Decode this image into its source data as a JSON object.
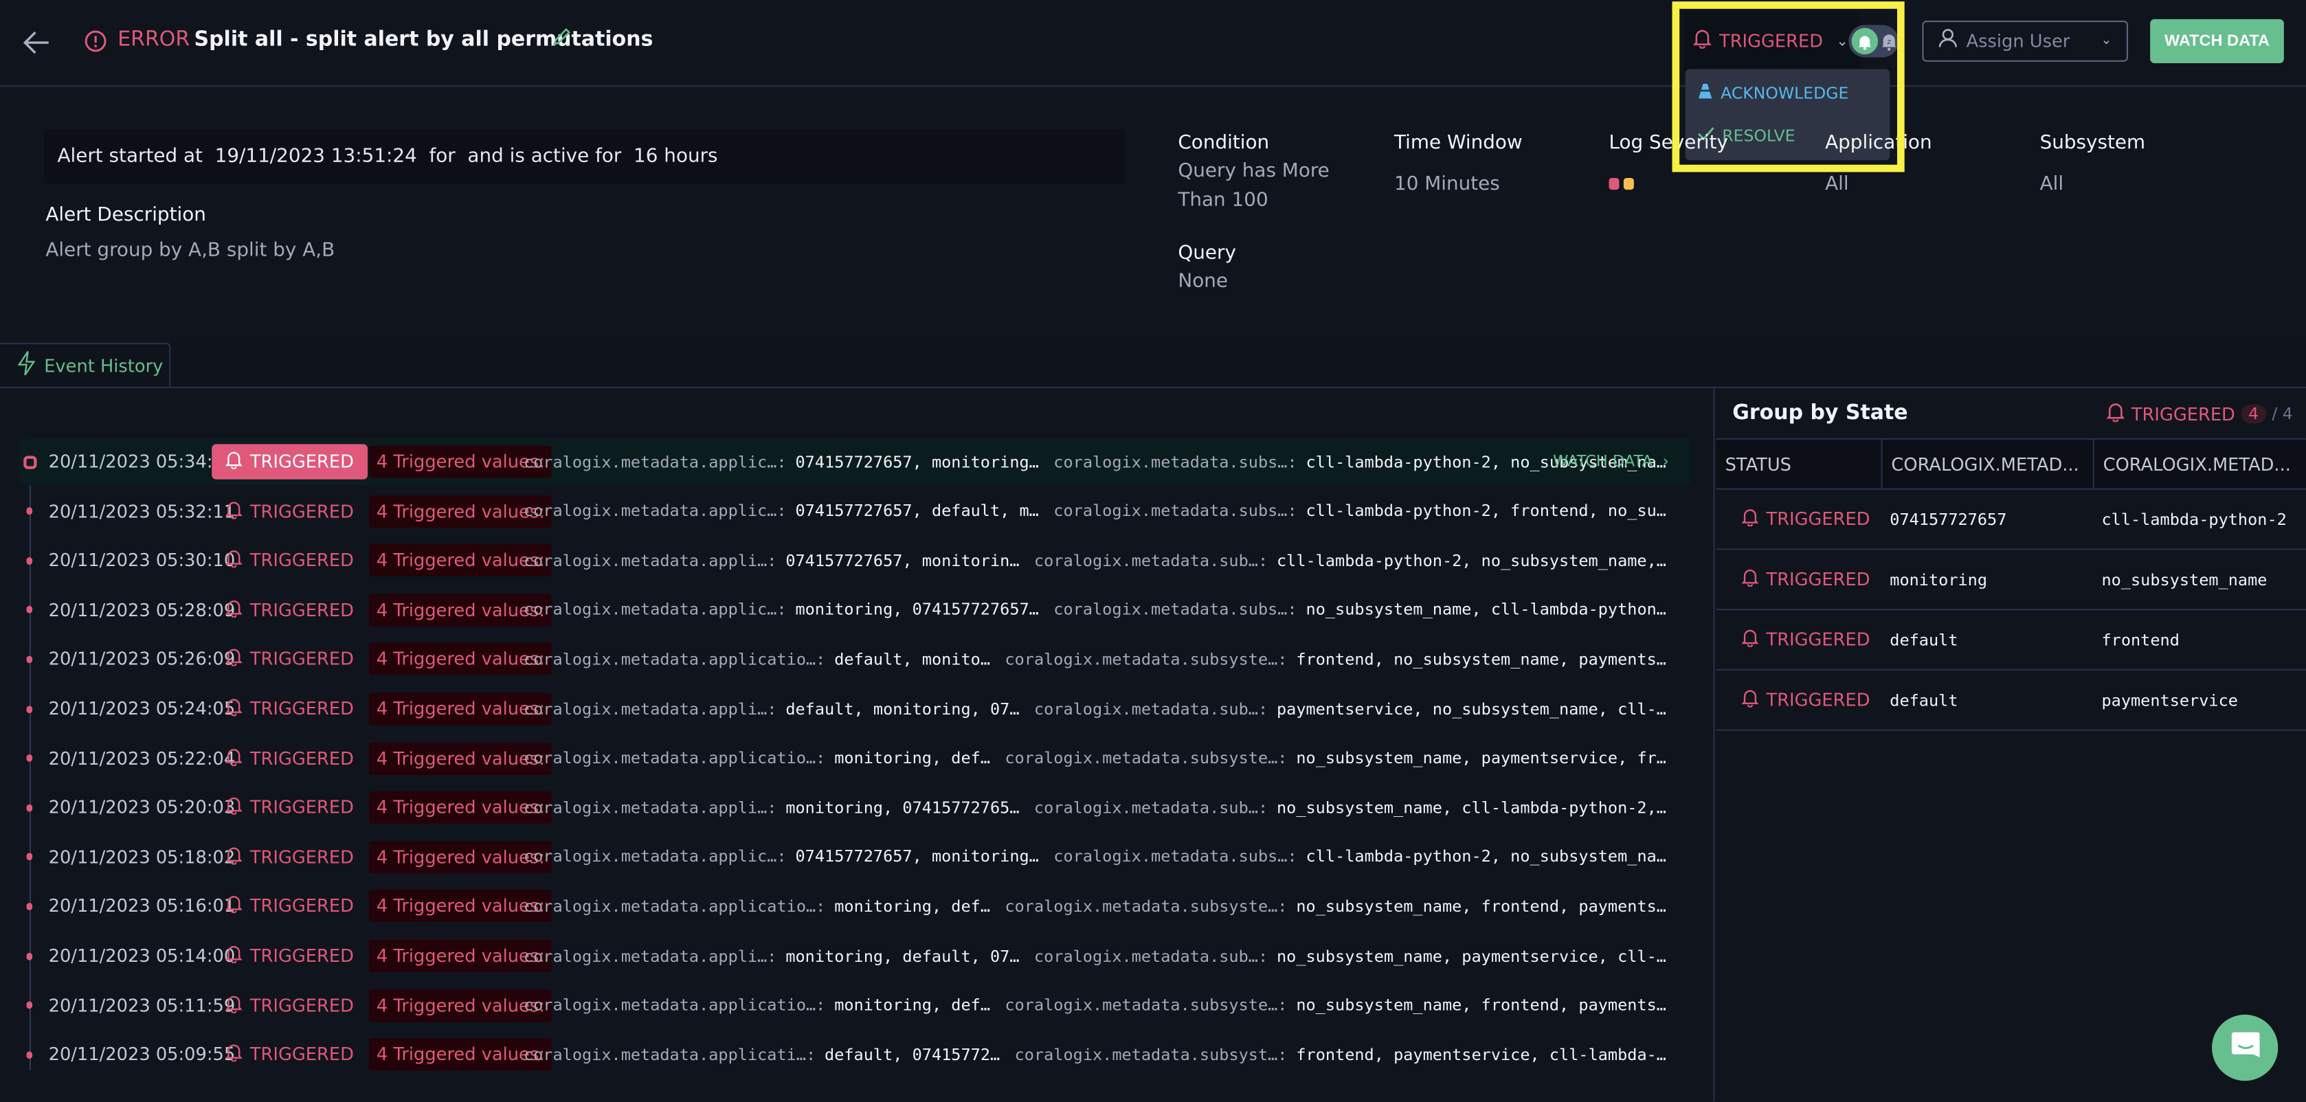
{
  "header": {
    "back_label": "Back",
    "severity": "ERROR",
    "title": "Split all - split alert by all permutations",
    "status_dropdown": {
      "label": "TRIGGERED"
    },
    "status_menu": [
      {
        "label": "ACKNOWLEDGE",
        "icon": "cone-icon",
        "color": "#58b8eb"
      },
      {
        "label": "RESOLVE",
        "icon": "check-icon",
        "color": "#67be8e"
      }
    ],
    "assign_user": {
      "placeholder": "Assign User"
    },
    "watch_data_label": "WATCH DATA"
  },
  "info": {
    "started_text": "Alert started at  19/11/2023 13:51:24  for  and is active for  16 hours",
    "description_heading": "Alert Description",
    "description": "Alert group by A,B split by A,B",
    "condition": {
      "heading": "Condition",
      "value": "Query has More Than 100"
    },
    "time_window": {
      "heading": "Time Window",
      "value": "10 Minutes"
    },
    "log_severity": {
      "heading": "Log Severity",
      "colors": [
        "#e0587a",
        "#f5c14c"
      ]
    },
    "application": {
      "heading": "Application",
      "value": "All"
    },
    "subsystem": {
      "heading": "Subsystem",
      "value": "All"
    },
    "query": {
      "heading": "Query",
      "value": "None"
    }
  },
  "tabs": [
    {
      "label": "Event History"
    }
  ],
  "events": {
    "status_label": "TRIGGERED",
    "values_label": "4 Triggered values:",
    "watch_data_label": "WATCH DATA",
    "rows": [
      {
        "time": "20/11/2023 05:34:12",
        "k1": "coralogix.metadata.applic…:",
        "v1": "074157727657, monitoring…",
        "k2": "coralogix.metadata.subs…:",
        "v2": "cll-lambda-python-2, no_subsystem_na…",
        "active": true
      },
      {
        "time": "20/11/2023 05:32:11",
        "k1": "coralogix.metadata.applic…:",
        "v1": "074157727657, default, m…",
        "k2": "coralogix.metadata.subs…:",
        "v2": "cll-lambda-python-2, frontend, no_su…"
      },
      {
        "time": "20/11/2023 05:30:10",
        "k1": "coralogix.metadata.appli…:",
        "v1": "074157727657, monitorin…",
        "k2": "coralogix.metadata.sub…:",
        "v2": "cll-lambda-python-2, no_subsystem_name,…"
      },
      {
        "time": "20/11/2023 05:28:09",
        "k1": "coralogix.metadata.applic…:",
        "v1": "monitoring, 074157727657…",
        "k2": "coralogix.metadata.subs…:",
        "v2": "no_subsystem_name, cll-lambda-python…"
      },
      {
        "time": "20/11/2023 05:26:09",
        "k1": "coralogix.metadata.applicatio…:",
        "v1": "default, monito…",
        "k2": "coralogix.metadata.subsyste…:",
        "v2": "frontend, no_subsystem_name, payments…"
      },
      {
        "time": "20/11/2023 05:24:05",
        "k1": "coralogix.metadata.appli…:",
        "v1": "default, monitoring, 07…",
        "k2": "coralogix.metadata.sub…:",
        "v2": "paymentservice, no_subsystem_name, cll-…"
      },
      {
        "time": "20/11/2023 05:22:04",
        "k1": "coralogix.metadata.applicatio…:",
        "v1": "monitoring, def…",
        "k2": "coralogix.metadata.subsyste…:",
        "v2": "no_subsystem_name, paymentservice, fr…"
      },
      {
        "time": "20/11/2023 05:20:03",
        "k1": "coralogix.metadata.appli…:",
        "v1": "monitoring, 07415772765…",
        "k2": "coralogix.metadata.sub…:",
        "v2": "no_subsystem_name, cll-lambda-python-2,…"
      },
      {
        "time": "20/11/2023 05:18:02",
        "k1": "coralogix.metadata.applic…:",
        "v1": "074157727657, monitoring…",
        "k2": "coralogix.metadata.subs…:",
        "v2": "cll-lambda-python-2, no_subsystem_na…"
      },
      {
        "time": "20/11/2023 05:16:01",
        "k1": "coralogix.metadata.applicatio…:",
        "v1": "monitoring, def…",
        "k2": "coralogix.metadata.subsyste…:",
        "v2": "no_subsystem_name, frontend, payments…"
      },
      {
        "time": "20/11/2023 05:14:00",
        "k1": "coralogix.metadata.appli…:",
        "v1": "monitoring, default, 07…",
        "k2": "coralogix.metadata.sub…:",
        "v2": "no_subsystem_name, paymentservice, cll-…"
      },
      {
        "time": "20/11/2023 05:11:59",
        "k1": "coralogix.metadata.applicatio…:",
        "v1": "monitoring, def…",
        "k2": "coralogix.metadata.subsyste…:",
        "v2": "no_subsystem_name, frontend, payments…"
      },
      {
        "time": "20/11/2023 05:09:55",
        "k1": "coralogix.metadata.applicati…:",
        "v1": "default, 07415772…",
        "k2": "coralogix.metadata.subsyst…:",
        "v2": "frontend, paymentservice, cll-lambda-…"
      }
    ]
  },
  "group_by_state": {
    "title": "Group by State",
    "summary_label": "TRIGGERED",
    "summary_count": "4",
    "summary_total": "/ 4",
    "columns": [
      "STATUS",
      "CORALOGIX.METAD...",
      "CORALOGIX.METAD..."
    ],
    "rows": [
      {
        "status": "TRIGGERED",
        "a": "074157727657",
        "b": "cll-lambda-python-2"
      },
      {
        "status": "TRIGGERED",
        "a": "monitoring",
        "b": "no_subsystem_name"
      },
      {
        "status": "TRIGGERED",
        "a": "default",
        "b": "frontend"
      },
      {
        "status": "TRIGGERED",
        "a": "default",
        "b": "paymentservice"
      }
    ]
  },
  "colors": {
    "accent": "#67be8e",
    "error": "#e0587a",
    "highlight": "#f7f046",
    "background": "#10141d"
  }
}
